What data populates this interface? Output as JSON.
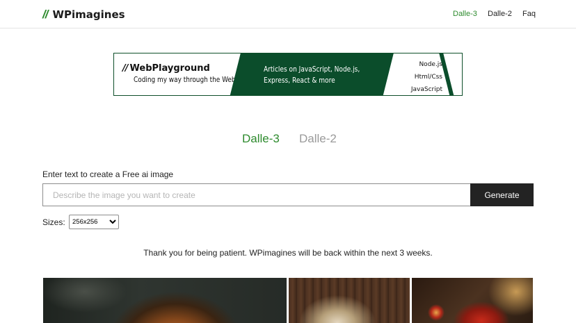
{
  "header": {
    "logo_mark": "//",
    "logo_text": "WPimagines",
    "nav": [
      "Dalle-3",
      "Dalle-2",
      "Faq"
    ]
  },
  "banner": {
    "brand_mark": "//",
    "brand": "WebPlayground",
    "tagline": "Coding my way through the Web",
    "headline": "Articles on JavaScript, Node.js, Express, React & more",
    "topics": [
      "Node.js",
      "Html/Css",
      "JavaScript"
    ]
  },
  "tabs": [
    "Dalle-3",
    "Dalle-2"
  ],
  "form": {
    "label": "Enter text to create a Free ai image",
    "placeholder": "Describe the image you want to create",
    "button": "Generate",
    "sizes_label": "Sizes:",
    "size_selected": "256x256"
  },
  "notice": "Thank you for being patient. WPimagines will be back within the next 3 weeks.",
  "colors": {
    "accent": "#2e8b2e",
    "banner_green": "#0b4d2b",
    "button": "#232323"
  }
}
